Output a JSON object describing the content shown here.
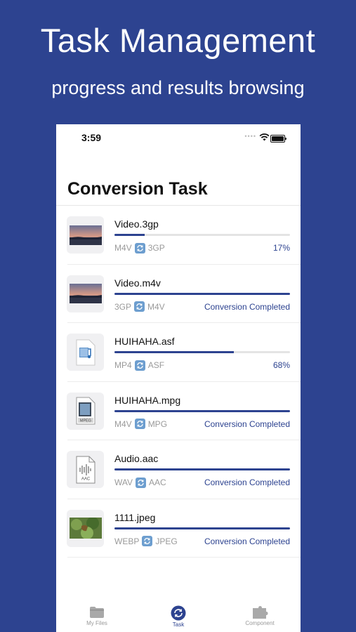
{
  "promo": {
    "title": "Task Management",
    "subtitle": "progress and results browsing"
  },
  "status_bar": {
    "time": "3:59"
  },
  "page": {
    "title": "Conversion Task"
  },
  "colors": {
    "brand": "#2d4390",
    "convert_icon": "#6d9ecf",
    "track": "#e4e4e4"
  },
  "tasks": [
    {
      "name": "Video.3gp",
      "from": "M4V",
      "to": "3GP",
      "progress": 0.17,
      "status": "17%",
      "thumb": "sunset-thumbnail-icon"
    },
    {
      "name": "Video.m4v",
      "from": "3GP",
      "to": "M4V",
      "progress": 1.0,
      "status": "Conversion Completed",
      "thumb": "sunset-thumbnail-icon"
    },
    {
      "name": "HUIHAHA.asf",
      "from": "MP4",
      "to": "ASF",
      "progress": 0.68,
      "status": "68%",
      "thumb": "video-file-icon"
    },
    {
      "name": "HUIHAHA.mpg",
      "from": "M4V",
      "to": "MPG",
      "progress": 1.0,
      "status": "Conversion Completed",
      "thumb": "mpeg-file-icon",
      "thumb_label": "MPEG"
    },
    {
      "name": "Audio.aac",
      "from": "WAV",
      "to": "AAC",
      "progress": 1.0,
      "status": "Conversion Completed",
      "thumb": "audio-file-icon",
      "thumb_label": "AAC"
    },
    {
      "name": "1111.jpeg",
      "from": "WEBP",
      "to": "JPEG",
      "progress": 1.0,
      "status": "Conversion Completed",
      "thumb": "photo-thumbnail-icon"
    }
  ],
  "tab_bar": {
    "items": [
      {
        "label": "My Files",
        "icon": "folder-icon"
      },
      {
        "label": "Task",
        "icon": "convert-icon",
        "active": true
      },
      {
        "label": "Component",
        "icon": "puzzle-icon"
      }
    ]
  }
}
